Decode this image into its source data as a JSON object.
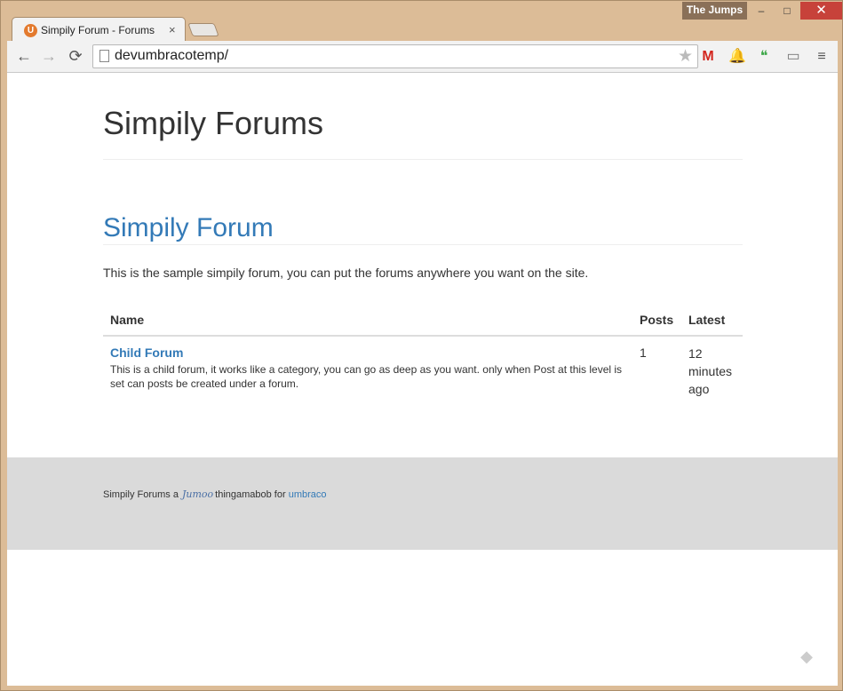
{
  "browser": {
    "profile_name": "The Jumps",
    "tab_title": "Simpily Forum - Forums",
    "tab_close": "×",
    "favicon": "U",
    "url": "devumbracotemp/",
    "controls": {
      "minimize": "–",
      "maximize": "□",
      "close": "✕"
    },
    "icons": {
      "back": "←",
      "forward": "→",
      "reload": "⟳",
      "star": "★",
      "gmail": "M",
      "bell": "🔔",
      "hangouts": "❝",
      "cast": "▭",
      "menu": "≡"
    }
  },
  "page": {
    "site_title": "Simpily Forums",
    "forum_heading": "Simpily Forum",
    "intro": "This is the sample simpily forum, you can put the forums anywhere you want on the site.",
    "table": {
      "headers": {
        "name": "Name",
        "posts": "Posts",
        "latest": "Latest"
      },
      "rows": [
        {
          "name": "Child Forum",
          "description": "This is a child forum, it works like a category, you can go as deep as you want. only when Post at this level is set can posts be created under a forum.",
          "posts": "1",
          "latest": "12 minutes ago"
        }
      ]
    },
    "footer": {
      "prefix": "Simpily Forums a",
      "brand": "Jumoo",
      "middle": "thingamabob for",
      "link": "umbraco"
    }
  },
  "colors": {
    "link": "#337ab7",
    "footer_bg": "#dadada",
    "close_button": "#c7423a"
  }
}
